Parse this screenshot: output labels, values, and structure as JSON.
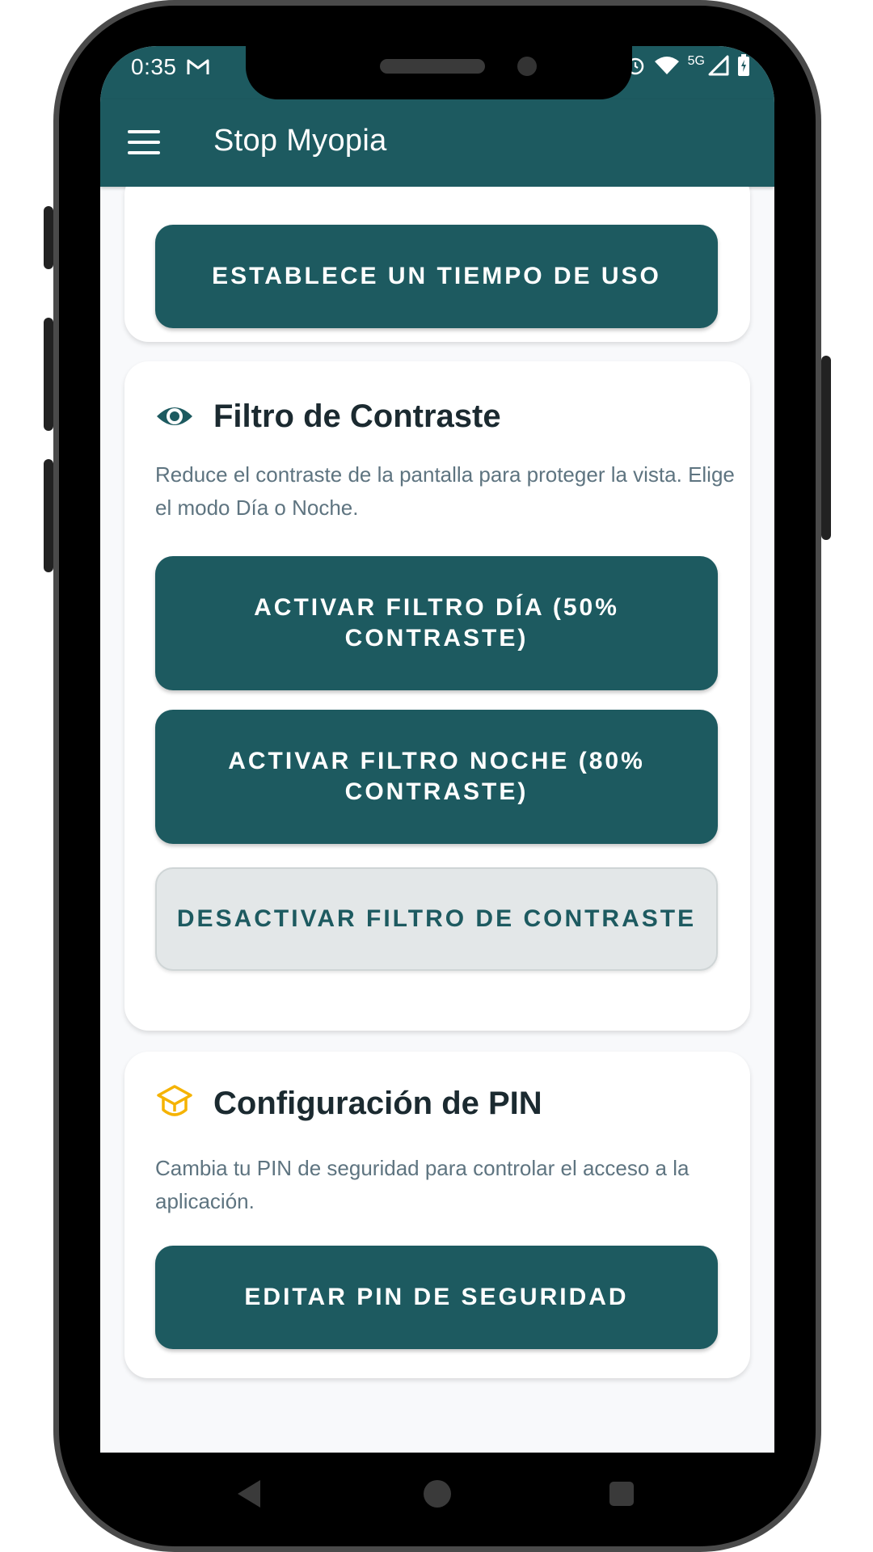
{
  "status_bar": {
    "time": "0:35",
    "network": "5G"
  },
  "app_bar": {
    "title": "Stop Myopia"
  },
  "usage_card": {
    "button_label": "ESTABLECE UN TIEMPO DE USO"
  },
  "contrast_card": {
    "icon": "eye-icon",
    "title": "Filtro de Contraste",
    "description": "Reduce el contraste de la pantalla para proteger la vista. Elige el modo Día o Noche.",
    "day_button": "ACTIVAR FILTRO DÍA (50% CONTRASTE)",
    "night_button": "ACTIVAR FILTRO NOCHE (80% CONTRASTE)",
    "disable_button": "DESACTIVAR FILTRO DE CONTRASTE"
  },
  "pin_card": {
    "icon": "shield-icon",
    "title": "Configuración de PIN",
    "description": "Cambia tu PIN de seguridad para controlar el acceso a la aplicación.",
    "edit_button": "EDITAR PIN DE SEGURIDAD"
  },
  "colors": {
    "primary": "#1d5a60",
    "accent": "#f5b301",
    "background": "#f8f9fb",
    "secondary_button": "#e3e7e8"
  }
}
